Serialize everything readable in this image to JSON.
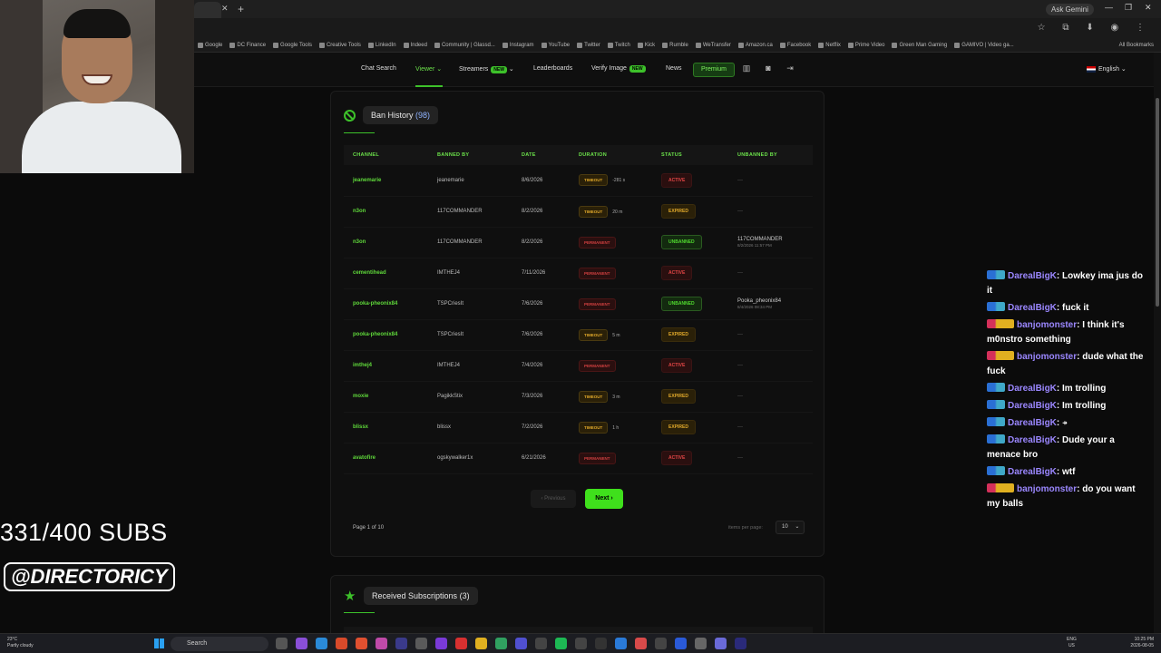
{
  "browser": {
    "tab_close": "✕",
    "new_tab": "+",
    "ask_gemini": "Ask Gemini",
    "window_controls": [
      "—",
      "❐",
      "✕"
    ],
    "bookmarks": [
      "Google",
      "DC Finance",
      "Google Tools",
      "Creative Tools",
      "LinkedIn",
      "Indeed",
      "Community | Glassd...",
      "Instagram",
      "YouTube",
      "Twitter",
      "Twitch",
      "Kick",
      "Rumble",
      "WeTransfer",
      "Amazon.ca",
      "Facebook",
      "Netflix",
      "Prime Video",
      "Green Man Gaming",
      "GAMIVO | Video ga..."
    ],
    "all_bookmarks": "All Bookmarks"
  },
  "nav": {
    "chat_search": "Chat Search",
    "viewer": "Viewer",
    "streamers": "Streamers",
    "new_badge": "NEW",
    "leaderboards": "Leaderboards",
    "verify_image": "Verify Image",
    "news": "News",
    "premium": "Premium",
    "language": "English"
  },
  "overlay": {
    "subs": "331/400 SUBS",
    "handle": "@DIRECTORICY"
  },
  "ban_history": {
    "title": "Ban History",
    "count": "(98)",
    "columns": [
      "CHANNEL",
      "BANNED BY",
      "DATE",
      "DURATION",
      "STATUS",
      "UNBANNED BY"
    ],
    "rows": [
      {
        "channel": "jeanemarie",
        "banned_by": "jeanemarie",
        "date": "8/6/2026",
        "type": "TIMEOUT",
        "dur": "-281 s",
        "status": "ACTIVE",
        "unbanned_by": "—",
        "unbanned_date": ""
      },
      {
        "channel": "n3on",
        "banned_by": "117COMMANDER",
        "date": "8/2/2026",
        "type": "TIMEOUT",
        "dur": "20 m",
        "status": "EXPIRED",
        "unbanned_by": "—",
        "unbanned_date": ""
      },
      {
        "channel": "n3on",
        "banned_by": "117COMMANDER",
        "date": "8/2/2026",
        "type": "PERMANENT",
        "dur": "",
        "status": "UNBANNED",
        "unbanned_by": "117COMMANDER",
        "unbanned_date": "8/2/2026 11:57 PM"
      },
      {
        "channel": "cementihead",
        "banned_by": "IMTHEJ4",
        "date": "7/11/2026",
        "type": "PERMANENT",
        "dur": "",
        "status": "ACTIVE",
        "unbanned_by": "—",
        "unbanned_date": ""
      },
      {
        "channel": "pooka-pheonix84",
        "banned_by": "TSPCriesIt",
        "date": "7/6/2026",
        "type": "PERMANENT",
        "dur": "",
        "status": "UNBANNED",
        "unbanned_by": "Pooka_pheonix84",
        "unbanned_date": "8/4/2026 08:34 PM"
      },
      {
        "channel": "pooka-pheonix84",
        "banned_by": "TSPCriesIt",
        "date": "7/6/2026",
        "type": "TIMEOUT",
        "dur": "5 m",
        "status": "EXPIRED",
        "unbanned_by": "—",
        "unbanned_date": ""
      },
      {
        "channel": "imthej4",
        "banned_by": "IMTHEJ4",
        "date": "7/4/2026",
        "type": "PERMANENT",
        "dur": "",
        "status": "ACTIVE",
        "unbanned_by": "—",
        "unbanned_date": ""
      },
      {
        "channel": "moxie",
        "banned_by": "PagikkStix",
        "date": "7/3/2026",
        "type": "TIMEOUT",
        "dur": "3 m",
        "status": "EXPIRED",
        "unbanned_by": "—",
        "unbanned_date": ""
      },
      {
        "channel": "blissx",
        "banned_by": "blissx",
        "date": "7/2/2026",
        "type": "TIMEOUT",
        "dur": "1 h",
        "status": "EXPIRED",
        "unbanned_by": "—",
        "unbanned_date": ""
      },
      {
        "channel": "avatofire",
        "banned_by": "ogskywalker1x",
        "date": "6/21/2026",
        "type": "PERMANENT",
        "dur": "",
        "status": "ACTIVE",
        "unbanned_by": "—",
        "unbanned_date": ""
      }
    ],
    "prev": "‹ Previous",
    "next": "Next ›",
    "page_of": "Page 1 of 10",
    "items_per_page": "items per page:",
    "ipp_value": "10"
  },
  "received_subs": {
    "title": "Received Subscriptions",
    "count": "(3)"
  },
  "chat": [
    {
      "badge": "a",
      "user": "DarealBigK",
      "text": ": Lowkey ima jus do it"
    },
    {
      "badge": "a",
      "user": "DarealBigK",
      "text": ": fuck it"
    },
    {
      "badge": "b",
      "user": "banjomonster",
      "text": ": I think it's m0nstro something"
    },
    {
      "badge": "b",
      "user": "banjomonster",
      "text": ": dude what the fuck"
    },
    {
      "badge": "a",
      "user": "DarealBigK",
      "text": ": Im trolling"
    },
    {
      "badge": "a",
      "user": "DarealBigK",
      "text": ": Im trolling"
    },
    {
      "badge": "a",
      "user": "DarealBigK",
      "text": ": ⍆"
    },
    {
      "badge": "a",
      "user": "DarealBigK",
      "text": ": Dude your a menace bro"
    },
    {
      "badge": "a",
      "user": "DarealBigK",
      "text": ": wtf"
    },
    {
      "badge": "b",
      "user": "banjomonster",
      "text": ": do you want my balls"
    }
  ],
  "taskbar": {
    "weather_temp": "23°C",
    "weather_desc": "Partly cloudy",
    "search": "Search",
    "lang1": "ENG",
    "lang2": "US",
    "time": "10:25 PM",
    "date": "2026-08-05"
  }
}
